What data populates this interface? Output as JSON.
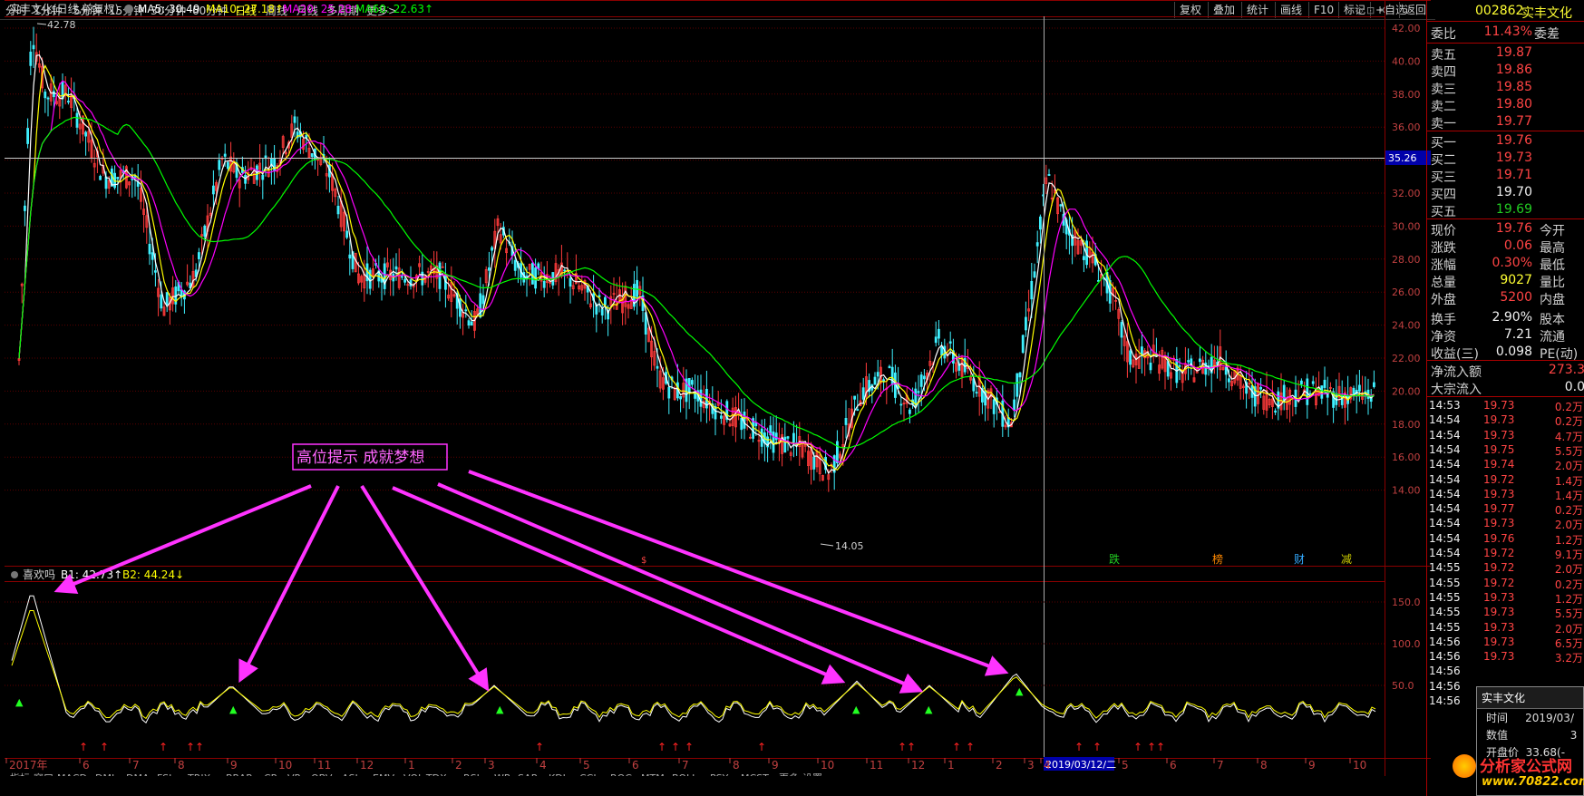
{
  "toolbar": {
    "periods": [
      "分时",
      "1分钟",
      "5分钟",
      "15分钟",
      "30分钟",
      "60分钟",
      "日线",
      "周线",
      "月线",
      "多周期",
      "更多>"
    ],
    "active_period": "日线",
    "right_buttons": [
      "复权",
      "叠加",
      "统计",
      "画线",
      "F10",
      "标记",
      "+自选",
      "返回"
    ]
  },
  "stock": {
    "code": "002862",
    "name": "实丰文化",
    "title": "实丰文化(日线,前复权)",
    "ma5": "MA5: 30.49",
    "ma10": "MA10: 27.18↑",
    "ma20": "MA20: 25.28↑",
    "ma60": "MA60: 22.63↑",
    "high_label": "42.78",
    "low_label": "14.05",
    "crosshair_price": "35.26",
    "crosshair_date": "2019/03/12/二"
  },
  "colors": {
    "ma5": "#ffffff",
    "ma10": "#ffff00",
    "ma20": "#ff00ff",
    "ma60": "#00ff00",
    "arrow": "#ff33ff"
  },
  "annotation": {
    "text": "高位提示  成就梦想"
  },
  "event_labels": [
    "跌",
    "榜",
    "财",
    "减"
  ],
  "price_axis": [
    "42.00",
    "40.00",
    "38.00",
    "36.00",
    "34.00",
    "32.00",
    "30.00",
    "28.00",
    "26.00",
    "24.00",
    "22.00",
    "20.00",
    "18.00",
    "16.00",
    "14.00"
  ],
  "indicator": {
    "name": "喜欢吗",
    "b1": "B1: 42.73↑",
    "b2": "B2: 44.24↓",
    "axis": [
      "150.0",
      "100.0",
      "50.0"
    ]
  },
  "time_axis": [
    "2017年",
    "6",
    "7",
    "8",
    "9",
    "10",
    "11",
    "12",
    "1",
    "2",
    "3",
    "4",
    "5",
    "6",
    "7",
    "8",
    "9",
    "10",
    "11",
    "12",
    "1",
    "2",
    "3",
    "4",
    "5",
    "6",
    "7",
    "8",
    "9",
    "10"
  ],
  "bottom_tabs": [
    "指标",
    "窗口",
    "MACD",
    "DMI",
    "DMA",
    "FSL",
    "TRIX",
    "BRAR",
    "CR",
    "VR",
    "OBV",
    "ASI",
    "EMV",
    "VOL-TDX",
    "RSI",
    "WR",
    "SAR",
    "KDJ",
    "CCI",
    "ROC",
    "MTM",
    "BOLL",
    "PSY",
    "MCST",
    "更多",
    "设置"
  ],
  "quote": {
    "weibi_label": "委比",
    "weibi": "11.43%",
    "weicha_label": "委差",
    "sell": [
      [
        "卖五",
        "19.87"
      ],
      [
        "卖四",
        "19.86"
      ],
      [
        "卖三",
        "19.85"
      ],
      [
        "卖二",
        "19.80"
      ],
      [
        "卖一",
        "19.77"
      ]
    ],
    "buy": [
      [
        "买一",
        "19.76"
      ],
      [
        "买二",
        "19.73"
      ],
      [
        "买三",
        "19.71"
      ],
      [
        "买四",
        "19.70"
      ],
      [
        "买五",
        "19.69"
      ]
    ],
    "stats": [
      [
        "现价",
        "19.76",
        "今开"
      ],
      [
        "涨跌",
        "0.06",
        "最高"
      ],
      [
        "涨幅",
        "0.30%",
        "最低"
      ],
      [
        "总量",
        "9027",
        "量比"
      ],
      [
        "外盘",
        "5200",
        "内盘"
      ],
      [
        "换手",
        "2.90%",
        "股本"
      ],
      [
        "净资",
        "7.21",
        "流通"
      ],
      [
        "收益(三)",
        "0.098",
        "PE(动)"
      ]
    ],
    "flow": [
      [
        "净流入额",
        "273.3"
      ],
      [
        "大宗流入",
        "0.0"
      ]
    ]
  },
  "ticks": [
    [
      "14:53",
      "19.73",
      "0.2万"
    ],
    [
      "14:54",
      "19.73",
      "0.2万"
    ],
    [
      "14:54",
      "19.73",
      "4.7万"
    ],
    [
      "14:54",
      "19.75",
      "5.5万"
    ],
    [
      "14:54",
      "19.74",
      "2.0万"
    ],
    [
      "14:54",
      "19.72",
      "1.4万"
    ],
    [
      "14:54",
      "19.73",
      "1.4万"
    ],
    [
      "14:54",
      "19.77",
      "0.2万"
    ],
    [
      "14:54",
      "19.73",
      "2.0万"
    ],
    [
      "14:54",
      "19.76",
      "1.2万"
    ],
    [
      "14:54",
      "19.72",
      "9.1万"
    ],
    [
      "14:55",
      "19.72",
      "2.0万"
    ],
    [
      "14:55",
      "19.72",
      "0.2万"
    ],
    [
      "14:55",
      "19.73",
      "1.2万"
    ],
    [
      "14:55",
      "19.73",
      "5.5万"
    ],
    [
      "14:55",
      "19.73",
      "2.0万"
    ],
    [
      "14:56",
      "19.73",
      "6.5万"
    ],
    [
      "14:56",
      "19.73",
      "3.2万"
    ],
    [
      "14:56",
      "",
      " "
    ],
    [
      "14:56",
      "",
      ""
    ],
    [
      "14:56",
      "",
      ""
    ]
  ],
  "popup": {
    "title": "实丰文化",
    "rows": [
      [
        "时间",
        "2019/03/"
      ],
      [
        "数值",
        "3"
      ],
      [
        "开盘价",
        "33.68(-"
      ]
    ]
  },
  "watermark": {
    "text": "分析家公式网",
    "url": "www.70822.com"
  }
}
